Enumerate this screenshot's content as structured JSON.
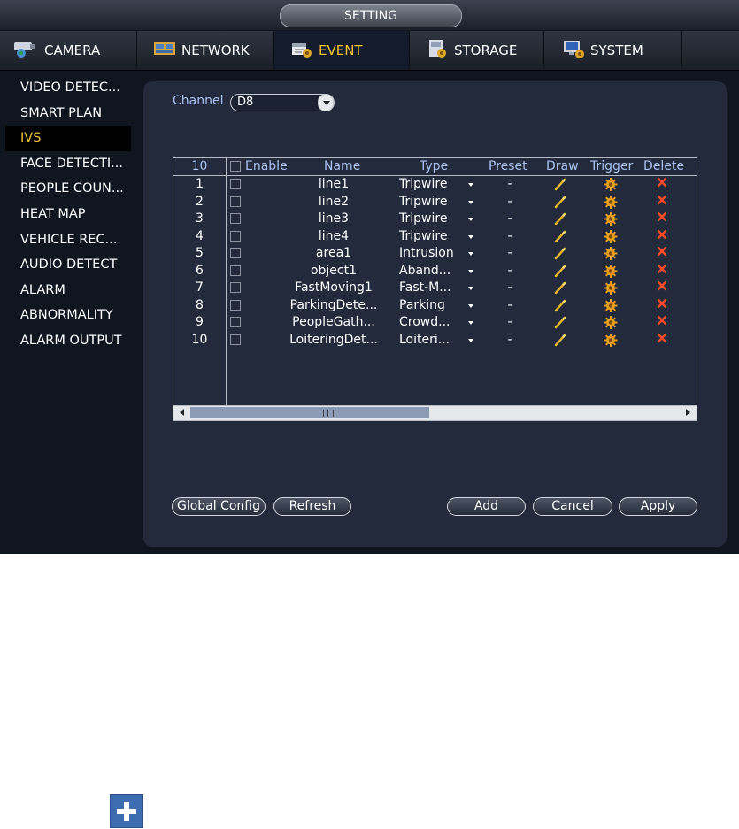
{
  "window": {
    "title": "SETTING"
  },
  "tabs": [
    {
      "label": "CAMERA",
      "icon": "camera-icon"
    },
    {
      "label": "NETWORK",
      "icon": "network-icon"
    },
    {
      "label": "EVENT",
      "icon": "event-icon",
      "active": true
    },
    {
      "label": "STORAGE",
      "icon": "storage-icon"
    },
    {
      "label": "SYSTEM",
      "icon": "system-icon"
    }
  ],
  "sidebar": {
    "items": [
      {
        "label": "VIDEO DETEC..."
      },
      {
        "label": "SMART PLAN"
      },
      {
        "label": "IVS",
        "active": true
      },
      {
        "label": "FACE DETECTI..."
      },
      {
        "label": "PEOPLE COUN..."
      },
      {
        "label": "HEAT MAP"
      },
      {
        "label": "VEHICLE REC..."
      },
      {
        "label": "AUDIO DETECT"
      },
      {
        "label": "ALARM"
      },
      {
        "label": "ABNORMALITY"
      },
      {
        "label": "ALARM OUTPUT"
      }
    ]
  },
  "channel": {
    "label": "Channel",
    "value": "D8"
  },
  "table": {
    "count": "10",
    "headers": {
      "enable": "Enable",
      "name": "Name",
      "type": "Type",
      "preset": "Preset",
      "draw": "Draw",
      "trigger": "Trigger",
      "delete": "Delete"
    },
    "rows": [
      {
        "no": "1",
        "name": "line1",
        "type": "Tripwire",
        "preset": "-"
      },
      {
        "no": "2",
        "name": "line2",
        "type": "Tripwire",
        "preset": "-"
      },
      {
        "no": "3",
        "name": "line3",
        "type": "Tripwire",
        "preset": "-"
      },
      {
        "no": "4",
        "name": "line4",
        "type": "Tripwire",
        "preset": "-"
      },
      {
        "no": "5",
        "name": "area1",
        "type": "Intrusion",
        "preset": "-"
      },
      {
        "no": "6",
        "name": "object1",
        "type": "Aband...",
        "preset": "-"
      },
      {
        "no": "7",
        "name": "FastMoving1",
        "type": "Fast-M...",
        "preset": "-"
      },
      {
        "no": "8",
        "name": "ParkingDete...",
        "type": "Parking",
        "preset": "-"
      },
      {
        "no": "9",
        "name": "PeopleGath...",
        "type": "Crowd...",
        "preset": "-"
      },
      {
        "no": "10",
        "name": "LoiteringDet...",
        "type": "Loiteri...",
        "preset": "-"
      }
    ]
  },
  "buttons": {
    "global_config": "Global Config",
    "refresh": "Refresh",
    "add": "Add",
    "cancel": "Cancel",
    "apply": "Apply"
  },
  "colors": {
    "accent": "#f1c232",
    "header_text": "#a9c2f2",
    "delete": "#ff4a2a"
  },
  "extra_icon": "plus-icon"
}
